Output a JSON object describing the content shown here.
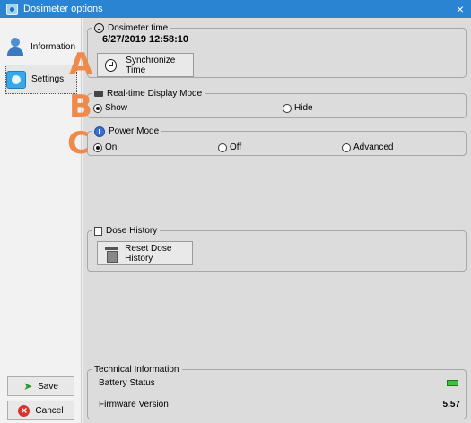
{
  "window": {
    "title": "Dosimeter options",
    "close_glyph": "×",
    "icon": "app-icon"
  },
  "sidebar": {
    "items": [
      {
        "label": "Information",
        "icon": "user-icon",
        "active": false
      },
      {
        "label": "Settings",
        "icon": "settings-icon",
        "active": true
      }
    ],
    "save_label": "Save",
    "cancel_label": "Cancel"
  },
  "dosimeter_time": {
    "title": "Dosimeter time",
    "value": "6/27/2019 12:58:10",
    "sync_button": "Synchronize Time"
  },
  "realtime_display": {
    "title": "Real-time Display Mode",
    "options": [
      {
        "label": "Show",
        "selected": true
      },
      {
        "label": "Hide",
        "selected": false
      }
    ]
  },
  "power_mode": {
    "title": "Power Mode",
    "options": [
      {
        "label": "On",
        "selected": true
      },
      {
        "label": "Off",
        "selected": false
      },
      {
        "label": "Advanced",
        "selected": false
      }
    ]
  },
  "dose_history": {
    "title": "Dose History",
    "reset_button": "Reset Dose History"
  },
  "technical": {
    "title": "Technical Information",
    "battery_label": "Battery Status",
    "firmware_label": "Firmware Version",
    "firmware_value": "5.57"
  },
  "annotations": {
    "a": "A",
    "b": "B",
    "c": "C"
  },
  "colors": {
    "titlebar": "#2a84d2",
    "annotation": "#f08a4b",
    "battery": "#3fbf3f"
  }
}
